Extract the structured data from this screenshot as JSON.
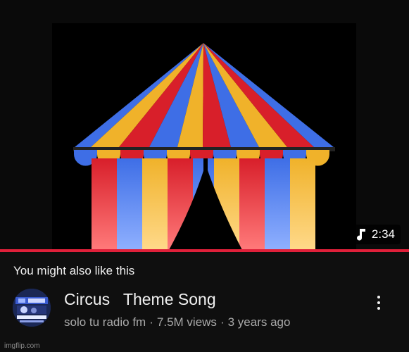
{
  "player": {
    "duration": "2:34",
    "duration_icon": "music-note-icon",
    "progress_color": "#e0203a",
    "thumbnail_colors": [
      "#d81f2a",
      "#3e6ee6",
      "#f0b22a"
    ]
  },
  "suggestions": {
    "heading": "You might also like this",
    "item": {
      "title": "Circus   Theme Song",
      "channel": "solo tu radio fm",
      "separator": "·",
      "views": "7.5M views",
      "age": "3 years ago",
      "more_icon": "more-vertical-icon"
    }
  },
  "watermark": "imgflip.com"
}
